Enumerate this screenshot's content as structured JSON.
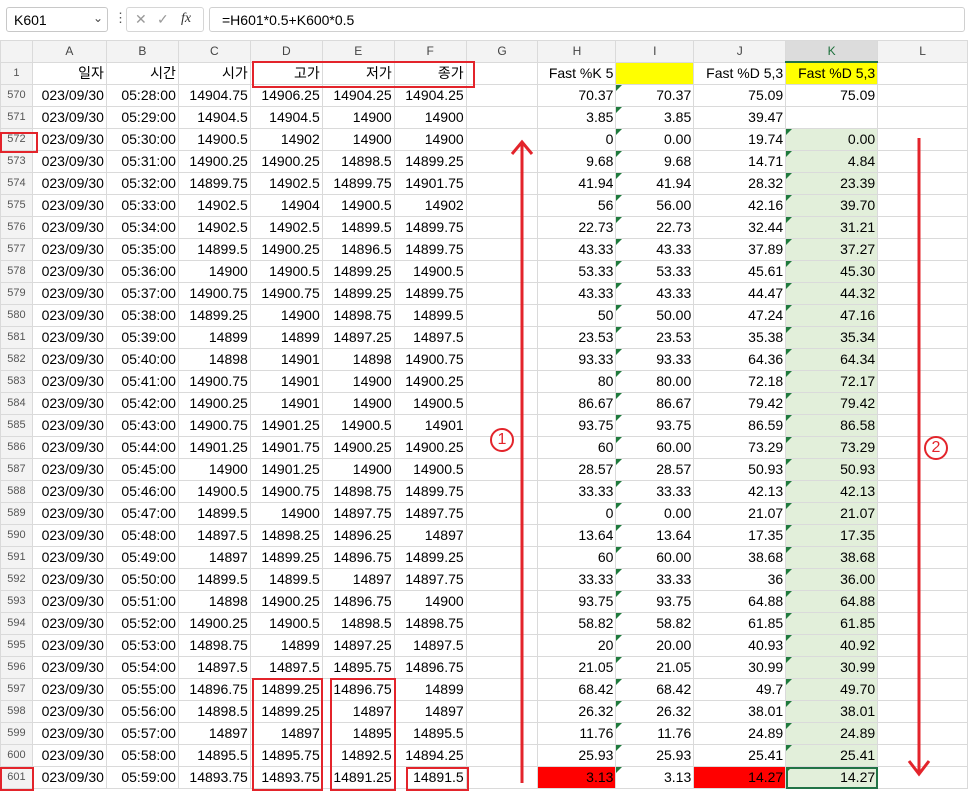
{
  "namebox": {
    "cell": "K601",
    "dropdown_icon": "chevron-down-icon"
  },
  "formula_bar": {
    "formula": "=H601*0.5+K600*0.5",
    "fx_label": "fx"
  },
  "columns": [
    "A",
    "B",
    "C",
    "D",
    "E",
    "F",
    "G",
    "H",
    "I",
    "J",
    "K",
    "L"
  ],
  "header_row": {
    "num": "1",
    "cells": [
      "일자",
      "시간",
      "시가",
      "고가",
      "저가",
      "종가",
      "",
      "Fast %K 5",
      "",
      "Fast %D 5,3",
      "Fast %D 5,3",
      ""
    ]
  },
  "rows": [
    {
      "num": "570",
      "cells": [
        "023/09/30",
        "05:28:00",
        "14904.75",
        "14906.25",
        "14904.25",
        "14904.25",
        "",
        "70.37",
        "70.37",
        "75.09",
        "75.09",
        ""
      ]
    },
    {
      "num": "571",
      "cells": [
        "023/09/30",
        "05:29:00",
        "14904.5",
        "14904.5",
        "14900",
        "14900",
        "",
        "3.85",
        "3.85",
        "39.47",
        "",
        ""
      ]
    },
    {
      "num": "572",
      "cells": [
        "023/09/30",
        "05:30:00",
        "14900.5",
        "14902",
        "14900",
        "14900",
        "",
        "0",
        "0.00",
        "19.74",
        "0.00",
        ""
      ]
    },
    {
      "num": "573",
      "cells": [
        "023/09/30",
        "05:31:00",
        "14900.25",
        "14900.25",
        "14898.5",
        "14899.25",
        "",
        "9.68",
        "9.68",
        "14.71",
        "4.84",
        ""
      ]
    },
    {
      "num": "574",
      "cells": [
        "023/09/30",
        "05:32:00",
        "14899.75",
        "14902.5",
        "14899.75",
        "14901.75",
        "",
        "41.94",
        "41.94",
        "28.32",
        "23.39",
        ""
      ]
    },
    {
      "num": "575",
      "cells": [
        "023/09/30",
        "05:33:00",
        "14902.5",
        "14904",
        "14900.5",
        "14902",
        "",
        "56",
        "56.00",
        "42.16",
        "39.70",
        ""
      ]
    },
    {
      "num": "576",
      "cells": [
        "023/09/30",
        "05:34:00",
        "14902.5",
        "14902.5",
        "14899.5",
        "14899.75",
        "",
        "22.73",
        "22.73",
        "32.44",
        "31.21",
        ""
      ]
    },
    {
      "num": "577",
      "cells": [
        "023/09/30",
        "05:35:00",
        "14899.5",
        "14900.25",
        "14896.5",
        "14899.75",
        "",
        "43.33",
        "43.33",
        "37.89",
        "37.27",
        ""
      ]
    },
    {
      "num": "578",
      "cells": [
        "023/09/30",
        "05:36:00",
        "14900",
        "14900.5",
        "14899.25",
        "14900.5",
        "",
        "53.33",
        "53.33",
        "45.61",
        "45.30",
        ""
      ]
    },
    {
      "num": "579",
      "cells": [
        "023/09/30",
        "05:37:00",
        "14900.75",
        "14900.75",
        "14899.25",
        "14899.75",
        "",
        "43.33",
        "43.33",
        "44.47",
        "44.32",
        ""
      ]
    },
    {
      "num": "580",
      "cells": [
        "023/09/30",
        "05:38:00",
        "14899.25",
        "14900",
        "14898.75",
        "14899.5",
        "",
        "50",
        "50.00",
        "47.24",
        "47.16",
        ""
      ]
    },
    {
      "num": "581",
      "cells": [
        "023/09/30",
        "05:39:00",
        "14899",
        "14899",
        "14897.25",
        "14897.5",
        "",
        "23.53",
        "23.53",
        "35.38",
        "35.34",
        ""
      ]
    },
    {
      "num": "582",
      "cells": [
        "023/09/30",
        "05:40:00",
        "14898",
        "14901",
        "14898",
        "14900.75",
        "",
        "93.33",
        "93.33",
        "64.36",
        "64.34",
        ""
      ]
    },
    {
      "num": "583",
      "cells": [
        "023/09/30",
        "05:41:00",
        "14900.75",
        "14901",
        "14900",
        "14900.25",
        "",
        "80",
        "80.00",
        "72.18",
        "72.17",
        ""
      ]
    },
    {
      "num": "584",
      "cells": [
        "023/09/30",
        "05:42:00",
        "14900.25",
        "14901",
        "14900",
        "14900.5",
        "",
        "86.67",
        "86.67",
        "79.42",
        "79.42",
        ""
      ]
    },
    {
      "num": "585",
      "cells": [
        "023/09/30",
        "05:43:00",
        "14900.75",
        "14901.25",
        "14900.5",
        "14901",
        "",
        "93.75",
        "93.75",
        "86.59",
        "86.58",
        ""
      ]
    },
    {
      "num": "586",
      "cells": [
        "023/09/30",
        "05:44:00",
        "14901.25",
        "14901.75",
        "14900.25",
        "14900.25",
        "",
        "60",
        "60.00",
        "73.29",
        "73.29",
        ""
      ]
    },
    {
      "num": "587",
      "cells": [
        "023/09/30",
        "05:45:00",
        "14900",
        "14901.25",
        "14900",
        "14900.5",
        "",
        "28.57",
        "28.57",
        "50.93",
        "50.93",
        ""
      ]
    },
    {
      "num": "588",
      "cells": [
        "023/09/30",
        "05:46:00",
        "14900.5",
        "14900.75",
        "14898.75",
        "14899.75",
        "",
        "33.33",
        "33.33",
        "42.13",
        "42.13",
        ""
      ]
    },
    {
      "num": "589",
      "cells": [
        "023/09/30",
        "05:47:00",
        "14899.5",
        "14900",
        "14897.75",
        "14897.75",
        "",
        "0",
        "0.00",
        "21.07",
        "21.07",
        ""
      ]
    },
    {
      "num": "590",
      "cells": [
        "023/09/30",
        "05:48:00",
        "14897.5",
        "14898.25",
        "14896.25",
        "14897",
        "",
        "13.64",
        "13.64",
        "17.35",
        "17.35",
        ""
      ]
    },
    {
      "num": "591",
      "cells": [
        "023/09/30",
        "05:49:00",
        "14897",
        "14899.25",
        "14896.75",
        "14899.25",
        "",
        "60",
        "60.00",
        "38.68",
        "38.68",
        ""
      ]
    },
    {
      "num": "592",
      "cells": [
        "023/09/30",
        "05:50:00",
        "14899.5",
        "14899.5",
        "14897",
        "14897.75",
        "",
        "33.33",
        "33.33",
        "36",
        "36.00",
        ""
      ]
    },
    {
      "num": "593",
      "cells": [
        "023/09/30",
        "05:51:00",
        "14898",
        "14900.25",
        "14896.75",
        "14900",
        "",
        "93.75",
        "93.75",
        "64.88",
        "64.88",
        ""
      ]
    },
    {
      "num": "594",
      "cells": [
        "023/09/30",
        "05:52:00",
        "14900.25",
        "14900.5",
        "14898.5",
        "14898.75",
        "",
        "58.82",
        "58.82",
        "61.85",
        "61.85",
        ""
      ]
    },
    {
      "num": "595",
      "cells": [
        "023/09/30",
        "05:53:00",
        "14898.75",
        "14899",
        "14897.25",
        "14897.5",
        "",
        "20",
        "20.00",
        "40.93",
        "40.92",
        ""
      ]
    },
    {
      "num": "596",
      "cells": [
        "023/09/30",
        "05:54:00",
        "14897.5",
        "14897.5",
        "14895.75",
        "14896.75",
        "",
        "21.05",
        "21.05",
        "30.99",
        "30.99",
        ""
      ]
    },
    {
      "num": "597",
      "cells": [
        "023/09/30",
        "05:55:00",
        "14896.75",
        "14899.25",
        "14896.75",
        "14899",
        "",
        "68.42",
        "68.42",
        "49.7",
        "49.70",
        ""
      ]
    },
    {
      "num": "598",
      "cells": [
        "023/09/30",
        "05:56:00",
        "14898.5",
        "14899.25",
        "14897",
        "14897",
        "",
        "26.32",
        "26.32",
        "38.01",
        "38.01",
        ""
      ]
    },
    {
      "num": "599",
      "cells": [
        "023/09/30",
        "05:57:00",
        "14897",
        "14897",
        "14895",
        "14895.5",
        "",
        "11.76",
        "11.76",
        "24.89",
        "24.89",
        ""
      ]
    },
    {
      "num": "600",
      "cells": [
        "023/09/30",
        "05:58:00",
        "14895.5",
        "14895.75",
        "14892.5",
        "14894.25",
        "",
        "25.93",
        "25.93",
        "25.41",
        "25.41",
        ""
      ]
    },
    {
      "num": "601",
      "cells": [
        "023/09/30",
        "05:59:00",
        "14893.75",
        "14893.75",
        "14891.25",
        "14891.5",
        "",
        "3.13",
        "3.13",
        "14.27",
        "14.27",
        ""
      ]
    }
  ],
  "annotations": {
    "circle1": "1",
    "circle2": "2"
  },
  "colors": {
    "accent": "#217346",
    "annotation": "#e3242b",
    "highlight_yellow": "#ffff00",
    "highlight_green": "#e2efda",
    "highlight_red": "#ff0000"
  }
}
